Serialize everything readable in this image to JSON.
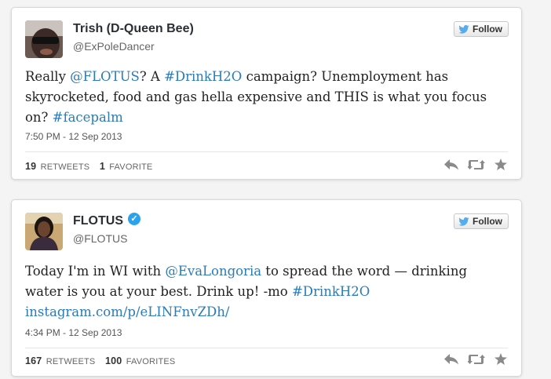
{
  "tweets": [
    {
      "name": "Trish (D-Queen Bee)",
      "handle": "@ExPoleDancer",
      "follow_label": "Follow",
      "text_parts": [
        "Really ",
        "@FLOTUS",
        "? A ",
        "#DrinkH2O",
        " campaign? Unemployment has skyrocketed, food and gas hella expensive and THIS is what you focus on? ",
        "#facepalm"
      ],
      "timestamp": "7:50 PM - 12 Sep 2013",
      "retweets_count": "19",
      "retweets_label": "RETWEETS",
      "favorites_count": "1",
      "favorites_label": "FAVORITE"
    },
    {
      "name": "FLOTUS",
      "handle": "@FLOTUS",
      "follow_label": "Follow",
      "text_parts": [
        "Today I'm in WI with ",
        "@EvaLongoria",
        " to spread the word — drinking water is you at your best. Drink up! -mo ",
        "#DrinkH2O",
        "instagram.com/p/eLINFnvZDh/"
      ],
      "timestamp": "4:34 PM - 12 Sep 2013",
      "retweets_count": "167",
      "retweets_label": "RETWEETS",
      "favorites_count": "100",
      "favorites_label": "FAVORITES"
    }
  ],
  "icons": {
    "follow": "twitter-bird-icon",
    "reply": "reply-icon",
    "retweet": "retweet-icon",
    "favorite": "star-icon",
    "verified": "verified-badge-icon"
  },
  "colors": {
    "link": "#2b7bb9",
    "bird": "#55acee",
    "verified": "#2aa3ef",
    "action_icons": "#8a8a8a"
  }
}
